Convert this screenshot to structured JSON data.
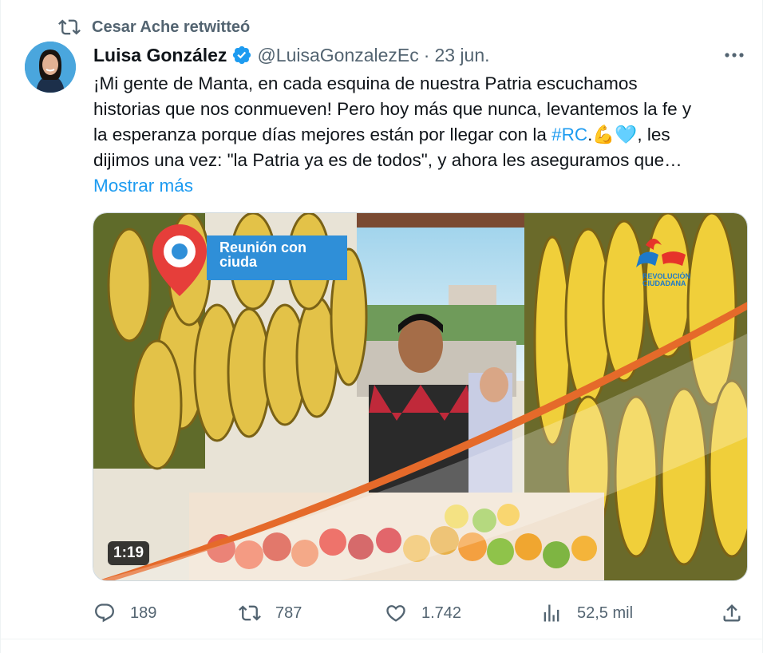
{
  "retweet": {
    "label": "Cesar Ache retwitteó",
    "icon": "retweet-icon"
  },
  "author": {
    "name": "Luisa González",
    "handle": "@LuisaGonzalezEc",
    "separator": "·",
    "date": "23 jun.",
    "verified": true
  },
  "tweet": {
    "text_part1": "¡Mi gente de Manta, en cada esquina de nuestra Patria escuchamos historias que nos conmueven! Pero hoy más que nunca, levantemos la fe y la esperanza porque días mejores están por llegar con la ",
    "hashtag": "#RC",
    "text_part2": ".💪🩵, les dijimos una vez: \"la Patria ya es de todos\", y ahora les aseguramos que…",
    "show_more": "Mostrar más"
  },
  "media": {
    "duration": "1:19",
    "overlay_text": "Reunión con ciuda",
    "brand_text": "REVOLUCIÓN CIUDADANA"
  },
  "actions": {
    "replies": "189",
    "retweets": "787",
    "likes": "1.742",
    "views": "52,5 mil"
  },
  "colors": {
    "accent": "#1d9bf0",
    "muted": "#536471",
    "overlay_blue": "#2f8fd8"
  }
}
